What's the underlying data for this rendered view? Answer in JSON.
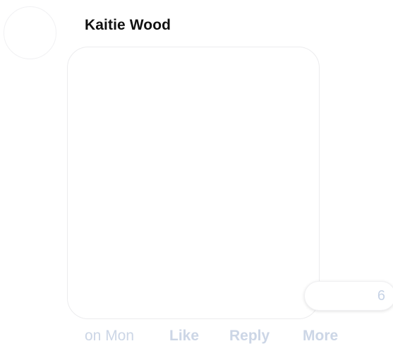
{
  "comment": {
    "author": "Kaitie Wood",
    "timestamp": "on Mon",
    "reaction_count": "6",
    "actions": {
      "like": "Like",
      "reply": "Reply",
      "more": "More"
    }
  },
  "colors": {
    "action_text": "#ccd6e6",
    "author_text": "#111111",
    "bubble_border": "#ececee"
  }
}
